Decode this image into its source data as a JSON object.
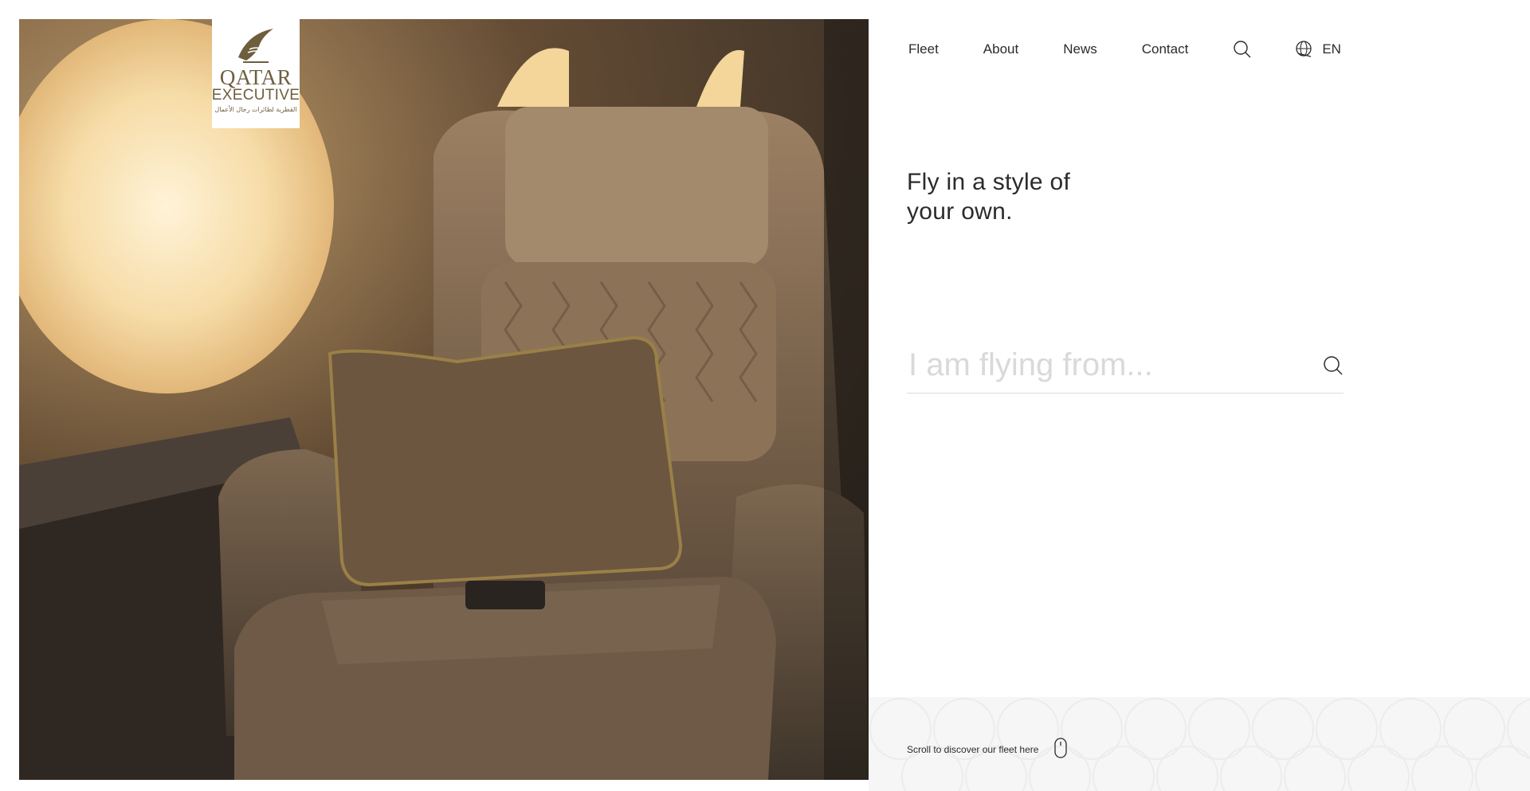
{
  "brand": {
    "name_line1": "QATAR",
    "name_line2": "EXECUTIVE",
    "name_arabic": "القطرية لطائرات رجال الأعمال",
    "color": "#6e5e3e"
  },
  "nav": {
    "items": [
      {
        "label": "Fleet"
      },
      {
        "label": "About"
      },
      {
        "label": "News"
      },
      {
        "label": "Contact"
      }
    ],
    "search_icon": "search-icon",
    "language_icon": "globe-icon",
    "language_code": "EN"
  },
  "hero": {
    "headline": "Fly in a style of your own."
  },
  "search": {
    "placeholder": "I am flying from..."
  },
  "scroll_hint": {
    "label": "Scroll to discover our fleet here",
    "icon": "mouse-icon"
  },
  "colors": {
    "text": "#2b2b2b",
    "placeholder": "#d9d9d9",
    "brand_gold": "#6e5e3e"
  }
}
